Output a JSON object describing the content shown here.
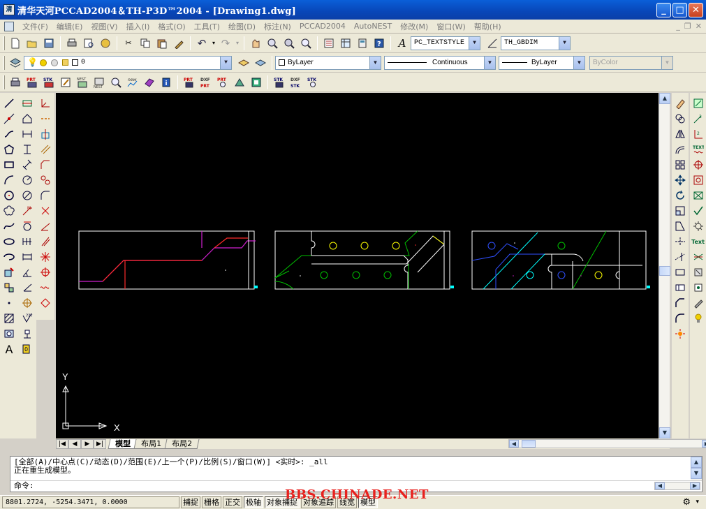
{
  "window": {
    "title": "清华天河PCCAD2004＆TH-P3D™2004 - [Drawing1.dwg]",
    "app_icon": "清",
    "buttons": [
      "_",
      "□",
      "✕"
    ]
  },
  "menu": {
    "items": [
      "文件(F)",
      "编辑(E)",
      "视图(V)",
      "插入(I)",
      "格式(O)",
      "工具(T)",
      "绘图(D)",
      "标注(N)",
      "PCCAD2004",
      "AutoNEST",
      "修改(M)",
      "窗口(W)",
      "帮助(H)"
    ]
  },
  "toolbar": {
    "text_style": "PC_TEXTSTYLE",
    "dim_style": "TH_GBDIM",
    "layer": "0",
    "color": "ByLayer",
    "linetype": "Continuous",
    "lineweight": "ByLayer",
    "plot_style": "ByColor"
  },
  "layout_tabs": [
    "模型",
    "布局1",
    "布局2"
  ],
  "ucs": {
    "x_label": "X",
    "y_label": "Y"
  },
  "command": {
    "line1": "[全部(A)/中心点(C)/动态(D)/范围(E)/上一个(P)/比例(S)/窗口(W)] <实时>: _all",
    "line2": "正在重生成模型。",
    "prompt": "命令:"
  },
  "status": {
    "coordinates": "8801.2724,  -5254.3471, 0.0000",
    "buttons": [
      {
        "label": "捕捉",
        "on": false
      },
      {
        "label": "栅格",
        "on": false
      },
      {
        "label": "正交",
        "on": false
      },
      {
        "label": "极轴",
        "on": true
      },
      {
        "label": "对象捕捉",
        "on": true
      },
      {
        "label": "对象追踪",
        "on": false
      },
      {
        "label": "线宽",
        "on": false
      },
      {
        "label": "模型",
        "on": true
      }
    ]
  },
  "watermark": "BBS.CHINADE.NET",
  "colors": {
    "canvas": "#000000",
    "title_bar": "#0a5fd8",
    "outline": "#ffffff",
    "red": "#ff2a2a",
    "magenta": "#d020d0",
    "yellow": "#ffff00",
    "green": "#00c000",
    "cyan": "#00ffff",
    "blue": "#3050ff"
  }
}
